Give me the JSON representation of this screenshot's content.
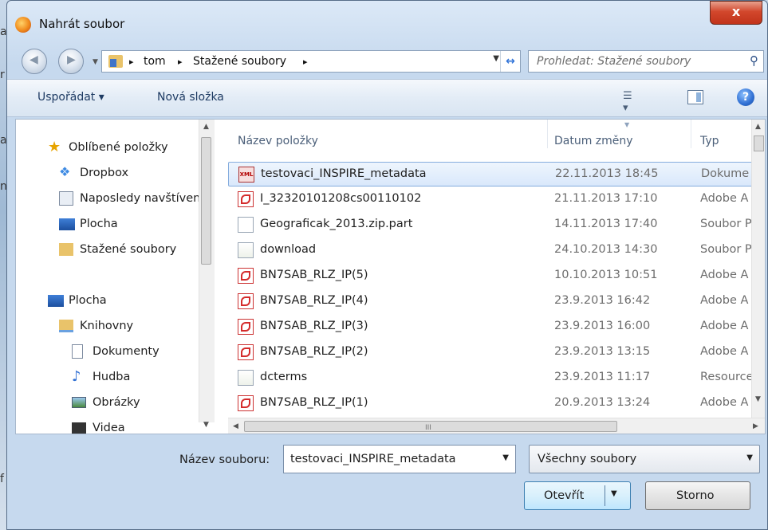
{
  "window": {
    "title": "Nahrát soubor",
    "close_label": "x"
  },
  "background": {
    "glyphs": [
      "a",
      "r",
      "a",
      "n",
      "f"
    ]
  },
  "address": {
    "crumbs": [
      "tom",
      "Stažené soubory"
    ],
    "separator": "▸",
    "refresh_label": "↔"
  },
  "search": {
    "placeholder": "Prohledat: Stažené soubory"
  },
  "toolbar": {
    "organize_label": "Uspořádat ▾",
    "new_folder_label": "Nová složka",
    "help_label": "?"
  },
  "nav_pane": {
    "items": [
      {
        "label": "Oblíbené položky",
        "icon": "star-icon"
      },
      {
        "label": "Dropbox",
        "icon": "dropbox-icon"
      },
      {
        "label": "Naposledy navštívené",
        "icon": "recent-places-icon"
      },
      {
        "label": "Plocha",
        "icon": "desktop-icon"
      },
      {
        "label": "Stažené soubory",
        "icon": "downloads-folder-icon"
      },
      {
        "label": "Plocha",
        "icon": "desktop-icon"
      },
      {
        "label": "Knihovny",
        "icon": "libraries-icon"
      },
      {
        "label": "Dokumenty",
        "icon": "documents-icon"
      },
      {
        "label": "Hudba",
        "icon": "music-icon"
      },
      {
        "label": "Obrázky",
        "icon": "pictures-icon"
      },
      {
        "label": "Videa",
        "icon": "videos-icon"
      }
    ]
  },
  "file_list": {
    "columns": [
      "Název položky",
      "Datum změny",
      "Typ"
    ],
    "rows": [
      {
        "name": "testovaci_INSPIRE_metadata",
        "date": "22.11.2013 18:45",
        "type": "Dokume",
        "icon": "xml-file-icon",
        "selected": true
      },
      {
        "name": "I_32320101208cs00110102",
        "date": "21.11.2013 17:10",
        "type": "Adobe A",
        "icon": "pdf-file-icon"
      },
      {
        "name": "Geograficak_2013.zip.part",
        "date": "14.11.2013 17:40",
        "type": "Soubor P",
        "icon": "blank-file-icon"
      },
      {
        "name": "download",
        "date": "24.10.2013 14:30",
        "type": "Soubor P",
        "icon": "text-file-icon"
      },
      {
        "name": "BN7SAB_RLZ_IP(5)",
        "date": "10.10.2013 10:51",
        "type": "Adobe A",
        "icon": "pdf-file-icon"
      },
      {
        "name": "BN7SAB_RLZ_IP(4)",
        "date": "23.9.2013 16:42",
        "type": "Adobe A",
        "icon": "pdf-file-icon"
      },
      {
        "name": "BN7SAB_RLZ_IP(3)",
        "date": "23.9.2013 16:00",
        "type": "Adobe A",
        "icon": "pdf-file-icon"
      },
      {
        "name": "BN7SAB_RLZ_IP(2)",
        "date": "23.9.2013 13:15",
        "type": "Adobe A",
        "icon": "pdf-file-icon"
      },
      {
        "name": "dcterms",
        "date": "23.9.2013 11:17",
        "type": "Resource",
        "icon": "text-file-icon"
      },
      {
        "name": "BN7SAB_RLZ_IP(1)",
        "date": "20.9.2013 13:24",
        "type": "Adobe A",
        "icon": "pdf-file-icon"
      }
    ]
  },
  "filename": {
    "label": "Název souboru:",
    "value": "testovaci_INSPIRE_metadata"
  },
  "filter": {
    "value": "Všechny soubory"
  },
  "buttons": {
    "open_label": "Otevřít",
    "cancel_label": "Storno"
  },
  "colors": {
    "selection": "#d9e8fb",
    "close_button": "#c1331a",
    "link_text": "#1e3b63"
  }
}
